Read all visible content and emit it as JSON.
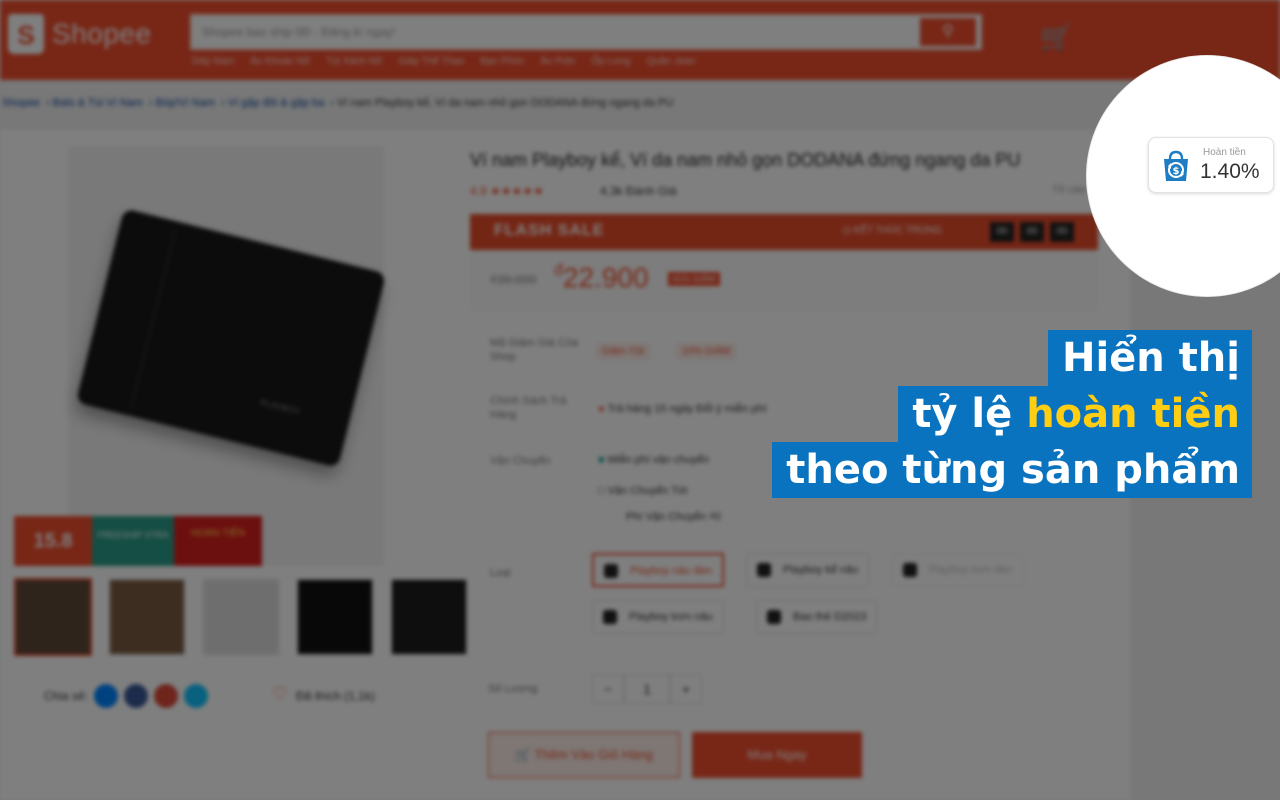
{
  "header": {
    "logo_text": "Shopee",
    "search_placeholder": "Shopee bao ship 0Đ - Đăng kí ngay!",
    "search_icon": "search-icon",
    "cart_icon": "cart-icon",
    "suggestions": [
      "Dép Nam",
      "Áo Khoác Nữ",
      "Túi Xách Nữ",
      "Giày Thể Thao",
      "Bạn Phím",
      "Áo Polo",
      "Ốp Lưng",
      "Quần Jean"
    ]
  },
  "breadcrumb": [
    "Shopee",
    "Balo & Túi Ví Nam",
    "Bóp/Ví Nam",
    "Ví gập đôi & gập ba",
    "Ví nam Playboy kể, Ví da nam nhỏ gọn DODANA đứng ngang da PU"
  ],
  "product": {
    "title": "Ví nam Playboy kể, Ví da nam nhỏ gọn DODANA đứng ngang da PU",
    "rating": "4.9",
    "stars": "★★★★★",
    "sold": "4,3k  Đánh Giá",
    "report": "Tố cáo",
    "flash_sale_label": "FLASH SALE",
    "flash_ends": "KẾT THÚC TRONG",
    "timer": [
      "00",
      "00",
      "00"
    ],
    "old_price": "₫39.000",
    "price_currency": "đ",
    "price": "22.900",
    "discount": "41% GIẢM",
    "voucher_label": "Mã Giảm Giá Của Shop",
    "vouchers": [
      "Giảm ₫1k",
      "10% GIẢM"
    ],
    "return_label": "Chính Sách Trả Hàng",
    "return_value": "Trả hàng 15 ngày    Đổi ý miễn phí",
    "shipping_label": "Vận Chuyển",
    "shipping_free": "Miễn phí vận chuyển",
    "shipping_to": "Vận Chuyển Tới",
    "shipping_fee": "Phí Vận Chuyển     ₫0",
    "variant_label": "Loại",
    "variants": [
      {
        "label": "Playboy nâu đen",
        "state": "selected"
      },
      {
        "label": "Playboy kể nâu",
        "state": "normal"
      },
      {
        "label": "Playboy trơn đen",
        "state": "disabled"
      },
      {
        "label": "Playboy trơn nâu",
        "state": "normal"
      },
      {
        "label": "Bao thẻ D2023",
        "state": "normal"
      }
    ],
    "quantity_label": "Số Lượng",
    "quantity": "1",
    "add_to_cart": "Thêm Vào Giỏ Hàng",
    "buy_now": "Mua Ngay",
    "share_label": "Chia sẻ:",
    "favorite": "Đã thích (1,1k)",
    "banner": [
      "15.8",
      "FREESHIP XTRA",
      "HOÀN TIỀN"
    ]
  },
  "extension_badge": {
    "label": "Hoàn tiền",
    "rate": "1.40%",
    "icon": "cashback-bag-icon",
    "accent_color": "#1f7dc4"
  },
  "caption": {
    "line1": "Hiển thị",
    "line2_a": "tỷ lệ ",
    "line2_b": "hoàn tiền",
    "line3": "theo từng sản phẩm",
    "bg_color": "#0a73c0",
    "highlight_color": "#ffcd12"
  }
}
